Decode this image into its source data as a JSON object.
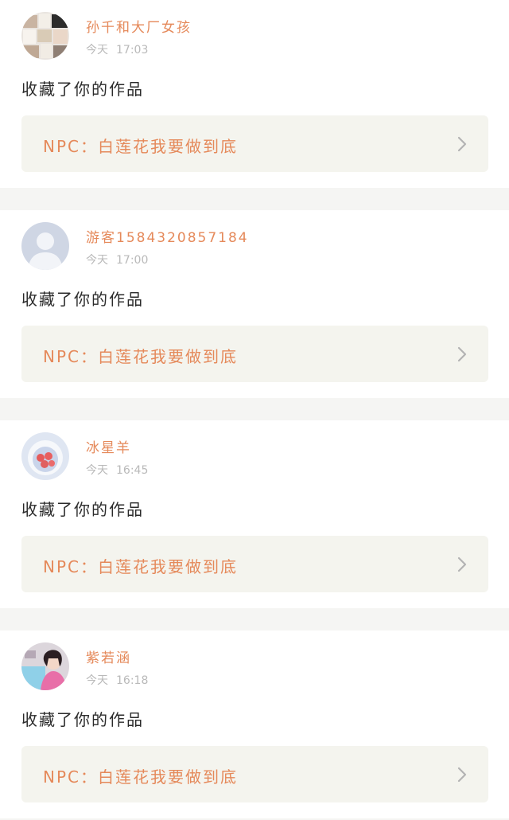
{
  "notifications": [
    {
      "username": "孙千和大厂女孩",
      "day": "今天",
      "time": "17:03",
      "action": "收藏了你的作品",
      "work_title": "NPC：白莲花我要做到底",
      "avatar_icon": "collage-avatar-icon"
    },
    {
      "username": "游客1584320857184",
      "day": "今天",
      "time": "17:00",
      "action": "收藏了你的作品",
      "work_title": "NPC：白莲花我要做到底",
      "avatar_icon": "default-user-avatar-icon"
    },
    {
      "username": "冰星羊",
      "day": "今天",
      "time": "16:45",
      "action": "收藏了你的作品",
      "work_title": "NPC：白莲花我要做到底",
      "avatar_icon": "bowl-avatar-icon"
    },
    {
      "username": "紫若涵",
      "day": "今天",
      "time": "16:18",
      "action": "收藏了你的作品",
      "work_title": "NPC：白莲花我要做到底",
      "avatar_icon": "portrait-avatar-icon"
    }
  ],
  "colors": {
    "accent": "#e5895a",
    "card_background": "#f4f4ee",
    "separator": "#f5f5f3",
    "timestamp": "#b9b9b9",
    "text": "#2b2b2b"
  }
}
